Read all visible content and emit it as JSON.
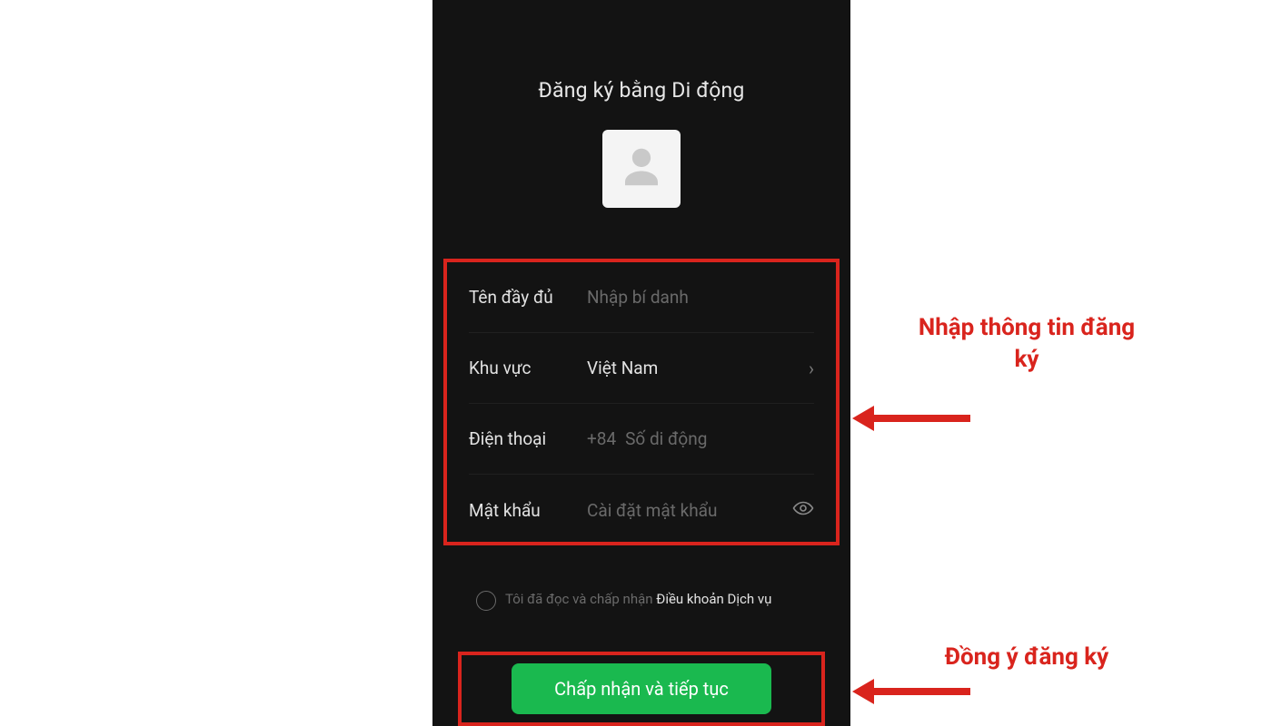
{
  "colors": {
    "accent": "#d9241d",
    "submit": "#1ab94f"
  },
  "screen": {
    "title": "Đăng ký bằng Di động",
    "avatar_icon": "person-silhouette-icon",
    "form": {
      "full_name": {
        "label": "Tên đầy đủ",
        "placeholder": "Nhập bí danh",
        "value": ""
      },
      "region": {
        "label": "Khu vực",
        "value": "Việt Nam"
      },
      "phone": {
        "label": "Điện thoại",
        "prefix": "+84",
        "placeholder": "Số di động",
        "value": ""
      },
      "password": {
        "label": "Mật khẩu",
        "placeholder": "Cài đặt mật khẩu",
        "value": ""
      }
    },
    "terms": {
      "prefix": "Tôi đã đọc và chấp nhận ",
      "link": "Điều khoản Dịch vụ",
      "checked": false
    },
    "submit_label": "Chấp nhận và tiếp tục"
  },
  "annotations": {
    "form_callout": "Nhập thông tin đăng ký",
    "submit_callout": "Đồng ý đăng ký"
  }
}
